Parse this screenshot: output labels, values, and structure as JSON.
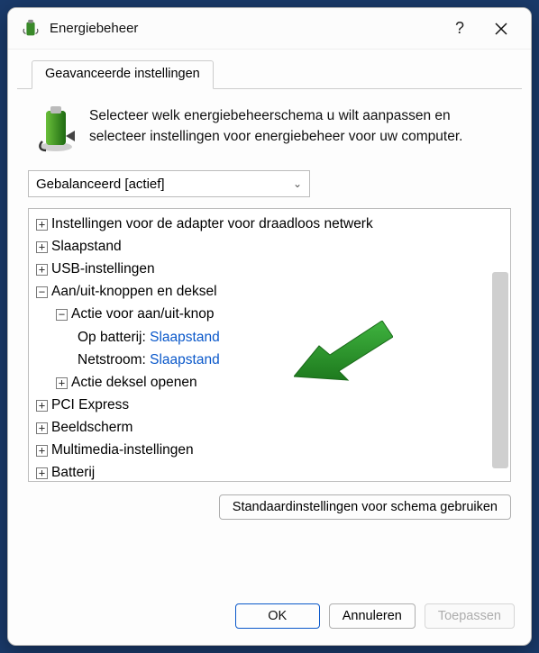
{
  "window": {
    "title": "Energiebeheer"
  },
  "tabs": {
    "advanced": "Geavanceerde instellingen"
  },
  "intro": "Selecteer welk energiebeheerschema u wilt aanpassen en selecteer instellingen voor energiebeheer voor uw computer.",
  "plan": {
    "selected": "Gebalanceerd [actief]"
  },
  "tree": {
    "wireless": "Instellingen voor de adapter voor draadloos netwerk",
    "sleep": "Slaapstand",
    "usb": "USB-instellingen",
    "buttons": "Aan/uit-knoppen en deksel",
    "buttons_children": {
      "power_action": "Actie voor aan/uit-knop",
      "power_action_battery_label": "Op batterij:",
      "power_action_battery_value": "Slaapstand",
      "power_action_ac_label": "Netstroom:",
      "power_action_ac_value": "Slaapstand",
      "lid_action": "Actie deksel openen"
    },
    "pci": "PCI Express",
    "display": "Beeldscherm",
    "multimedia": "Multimedia-instellingen",
    "battery": "Batterij"
  },
  "glyph": {
    "plus": "+",
    "minus": "−"
  },
  "buttons": {
    "restore_defaults": "Standaardinstellingen voor schema gebruiken",
    "ok": "OK",
    "cancel": "Annuleren",
    "apply": "Toepassen"
  }
}
